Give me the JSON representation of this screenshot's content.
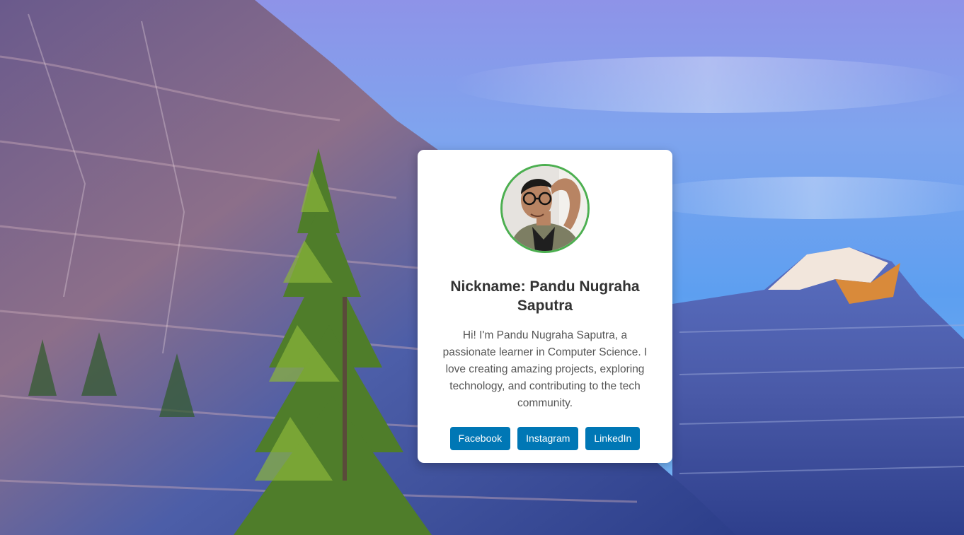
{
  "profile": {
    "avatar_alt": "Profile photo",
    "name": "Nickname: Pandu Nugraha Saputra",
    "bio": "Hi! I'm Pandu Nugraha Saputra, a passionate learner in Computer Science. I love creating amazing projects, exploring technology, and contributing to the tech community."
  },
  "links": [
    {
      "label": "Facebook",
      "icon": "facebook"
    },
    {
      "label": "Instagram",
      "icon": "instagram"
    },
    {
      "label": "LinkedIn",
      "icon": "linkedin"
    }
  ],
  "colors": {
    "button": "#0077b5",
    "avatar_border": "#4caf50",
    "heading_text": "#333333",
    "body_text": "#555555",
    "card_background": "#ffffff"
  }
}
